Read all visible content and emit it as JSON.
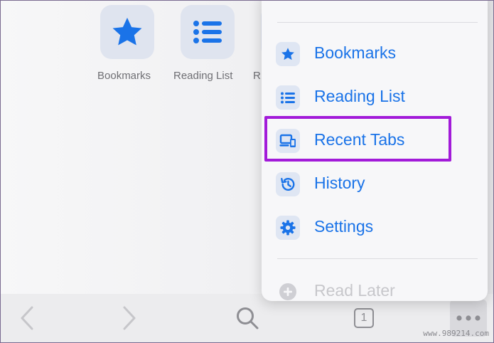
{
  "shortcuts": [
    {
      "label": "Bookmarks",
      "icon": "star-icon"
    },
    {
      "label": "Reading List",
      "icon": "list-icon"
    },
    {
      "label": "R",
      "icon": "partial-tile"
    }
  ],
  "menu": {
    "items": [
      {
        "label": "Bookmarks",
        "icon": "star-icon"
      },
      {
        "label": "Reading List",
        "icon": "list-icon"
      },
      {
        "label": "Recent Tabs",
        "icon": "devices-icon",
        "highlighted": true
      },
      {
        "label": "History",
        "icon": "history-icon"
      },
      {
        "label": "Settings",
        "icon": "gear-icon"
      },
      {
        "label": "Read Later",
        "icon": "add-circle-icon",
        "disabled": true
      }
    ]
  },
  "toolbar": {
    "tab_count": "1",
    "buttons": [
      "back-icon",
      "forward-icon",
      "search-icon",
      "tab-switcher-icon",
      "more-icon"
    ]
  },
  "colors": {
    "accent": "#1a73e8",
    "highlight": "#a21bd9",
    "icon_bg": "#dfe6f3"
  },
  "watermark": "www.989214.com"
}
